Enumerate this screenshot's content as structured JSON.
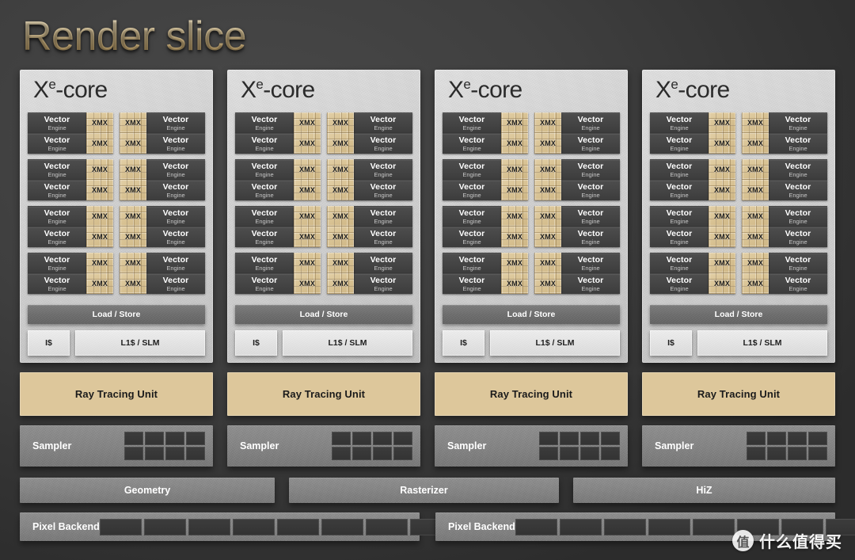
{
  "title": "Render slice",
  "xecore": {
    "logo_main": "X",
    "logo_sup": "e",
    "logo_suffix": "-core",
    "vector_engine_line1": "Vector",
    "vector_engine_line2": "Engine",
    "xmx_label": "XMX",
    "load_store_label": "Load / Store",
    "icache_label": "I$",
    "l1_slm_label": "L1$ / SLM",
    "group_count": 4,
    "engines_per_group_side": 2,
    "panel_count": 4
  },
  "ray_tracing": {
    "label": "Ray Tracing Unit",
    "count": 4
  },
  "sampler": {
    "label": "Sampler",
    "count": 4,
    "grid_cols": 4,
    "grid_rows": 2
  },
  "fixed_function_bars": [
    {
      "label": "Geometry"
    },
    {
      "label": "Rasterizer"
    },
    {
      "label": "HiZ"
    }
  ],
  "pixel_backend": [
    {
      "label": "Pixel Backend",
      "cells": 8
    },
    {
      "label": "Pixel Backend",
      "cells": 8
    }
  ],
  "watermark": {
    "logo_glyph": "值",
    "text": "什么值得买"
  },
  "colors": {
    "background": "#383838",
    "title_gold": "#e0c territory",
    "title_gold_hex": "#e3cb93",
    "panel_light": "#d8d8d8",
    "vector_engine_dark": "#454545",
    "xmx_tan": "#d8c293",
    "ray_tracing_tan": "#ddc79b",
    "bar_gray": "#848484",
    "cell_dark": "#363636",
    "cache_light": "#e6e6e6"
  }
}
